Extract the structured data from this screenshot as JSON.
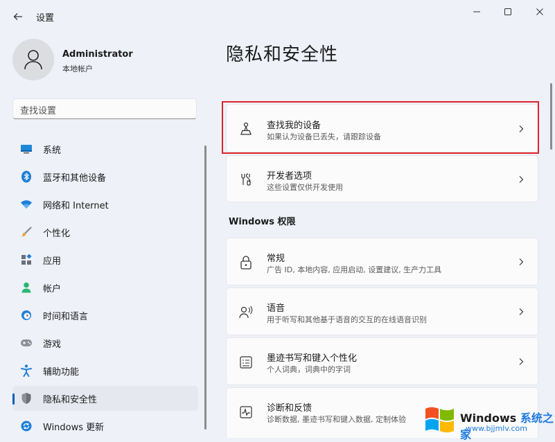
{
  "window": {
    "title": "设置"
  },
  "profile": {
    "name": "Administrator",
    "account_type": "本地帐户"
  },
  "search": {
    "placeholder": "查找设置"
  },
  "sidebar": {
    "items": [
      {
        "label": "系统",
        "icon": "monitor-icon"
      },
      {
        "label": "蓝牙和其他设备",
        "icon": "bluetooth-icon"
      },
      {
        "label": "网络和 Internet",
        "icon": "wifi-icon"
      },
      {
        "label": "个性化",
        "icon": "brush-icon"
      },
      {
        "label": "应用",
        "icon": "apps-icon"
      },
      {
        "label": "帐户",
        "icon": "person-icon"
      },
      {
        "label": "时间和语言",
        "icon": "clock-globe-icon"
      },
      {
        "label": "游戏",
        "icon": "gamepad-icon"
      },
      {
        "label": "辅助功能",
        "icon": "accessibility-icon"
      },
      {
        "label": "隐私和安全性",
        "icon": "shield-icon",
        "active": true
      },
      {
        "label": "Windows 更新",
        "icon": "update-icon"
      }
    ]
  },
  "main": {
    "title": "隐私和安全性",
    "top_cards": [
      {
        "title": "查找我的设备",
        "subtitle": "如果认为设备已丢失，请跟踪设备",
        "icon": "find-device-icon"
      },
      {
        "title": "开发者选项",
        "subtitle": "这些设置仅供开发使用",
        "icon": "developer-tools-icon"
      }
    ],
    "section_heading": "Windows 权限",
    "permission_cards": [
      {
        "title": "常规",
        "subtitle": "广告 ID, 本地内容, 应用启动, 设置建议, 生产力工具",
        "icon": "lock-icon"
      },
      {
        "title": "语音",
        "subtitle": "用于听写和其他基于语音的交互的在线语音识别",
        "icon": "speech-icon"
      },
      {
        "title": "墨迹书写和键入个性化",
        "subtitle": "个人词典，词典中的字词",
        "icon": "inking-icon"
      },
      {
        "title": "诊断和反馈",
        "subtitle": "诊断数据, 墨迹书写和键入数据, 定制体验",
        "icon": "diagnostics-icon"
      }
    ]
  },
  "watermark": {
    "title_en": "Windows",
    "title_cn": "系统之家",
    "url": "www.bjjmlv.com"
  },
  "colors": {
    "accent": "#005fb8",
    "highlight_border": "#e0232b",
    "background": "#eef1f7"
  }
}
